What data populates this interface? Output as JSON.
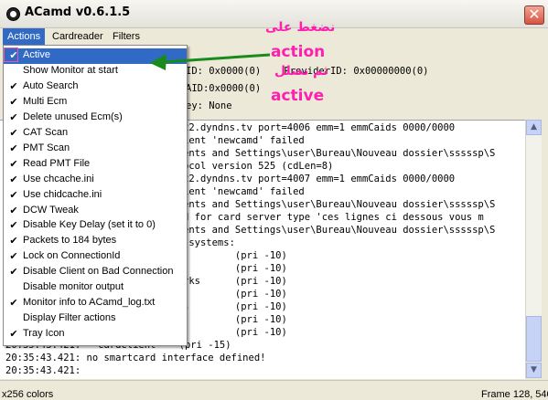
{
  "window": {
    "title": "ACamd v0.6.1.5",
    "close_glyph": "✕"
  },
  "menubar": {
    "items": [
      "Actions",
      "Cardreader",
      "Filters"
    ]
  },
  "header_lines": [
    "ID: 0x0000(0)    ProviderID: 0x00000000(0)",
    "AID:0x0000(0)",
    "ey: None"
  ],
  "log_lines": [
    "22.dyndns.tv port=4006 emm=1 emmCaids 0000/0000",
    "ient 'newcamd' failed",
    "ents and Settings\\user\\Bureau\\Nouveau dossier\\sssssp\\S",
    "ocol version 525 (cdLen=8)",
    "22.dyndns.tv port=4007 emm=1 emmCaids 0000/0000",
    "ient 'newcamd' failed",
    "ents and Settings\\user\\Bureau\\Nouveau dossier\\sssssp\\S",
    "d for card server type 'ces lignes ci dessous vous m",
    "ents and Settings\\user\\Bureau\\Nouveau dossier\\sssssp\\S",
    " systems:",
    "         (pri -10)",
    "         (pri -10)",
    "rks      (pri -10)",
    "         (pri -10)",
    "s        (pri -10)",
    "         (pri -10)",
    "         (pri -10)",
    "20:35:43.421:   cardclient    (pri -15)",
    "20:35:43.421: no smartcard interface defined!",
    "20:35:43.421:"
  ],
  "actions_menu": {
    "items": [
      {
        "label": "Active",
        "checked": true,
        "highlighted": true
      },
      {
        "label": "Show Monitor at start",
        "checked": false
      },
      {
        "label": "Auto Search",
        "checked": true
      },
      {
        "label": "Multi Ecm",
        "checked": true
      },
      {
        "label": "Delete unused Ecm(s)",
        "checked": true
      },
      {
        "label": "CAT Scan",
        "checked": true
      },
      {
        "label": "PMT Scan",
        "checked": true
      },
      {
        "label": "Read PMT File",
        "checked": true
      },
      {
        "label": "Use chcache.ini",
        "checked": true
      },
      {
        "label": "Use chidcache.ini",
        "checked": true
      },
      {
        "label": "DCW Tweak",
        "checked": true
      },
      {
        "label": "Disable Key Delay (set it to 0)",
        "checked": true
      },
      {
        "label": "Packets to 184 bytes",
        "checked": true
      },
      {
        "label": "Lock on ConnectionId",
        "checked": true
      },
      {
        "label": "Disable Client on Bad Connection",
        "checked": true
      },
      {
        "label": "Disable monitor output",
        "checked": false
      },
      {
        "label": "Monitor info to ACamd_log.txt",
        "checked": true
      },
      {
        "label": "Display Filter actions",
        "checked": false
      },
      {
        "label": "Tray Icon",
        "checked": true
      }
    ],
    "check_glyph": "✔"
  },
  "annotations": {
    "line1": "نضغط على",
    "line2": "action",
    "line3": "ثم نضلل",
    "line4": "active",
    "color": "#ff1fae",
    "arrow_color": "#1a8a1a"
  },
  "statusbar": {
    "left": "x256 colors",
    "right": "Frame 128, 540"
  },
  "scrollbar": {
    "up_glyph": "▲",
    "down_glyph": "▼"
  }
}
